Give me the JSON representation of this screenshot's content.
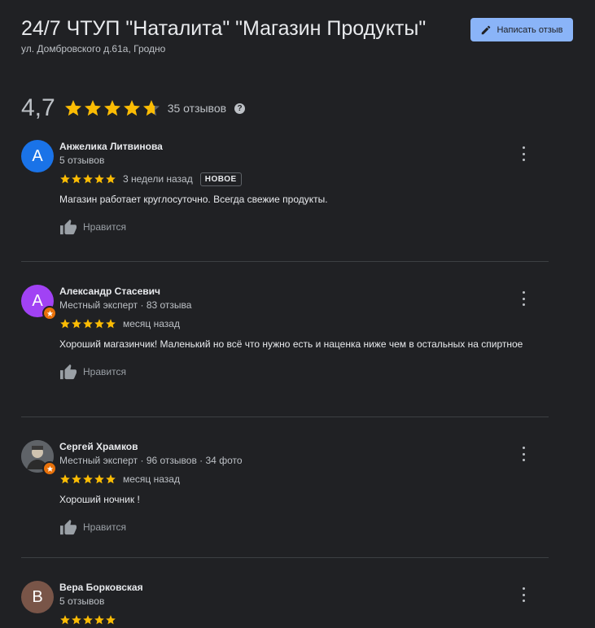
{
  "place": {
    "title": "24/7 ЧТУП \"Наталита\" \"Магазин Продукты\"",
    "address": "ул. Домбровского д.61а, Гродно"
  },
  "write_button": {
    "label": "Написать отзыв",
    "icon": "pencil-icon"
  },
  "summary": {
    "rating": "4,7",
    "rating_value": 4.7,
    "reviews_count": "35 отзывов",
    "help_symbol": "?"
  },
  "colors": {
    "star": "#fbbc04",
    "accent": "#8ab4f8",
    "background": "#202124",
    "badge": "#e8710a"
  },
  "reviews": [
    {
      "avatar_letter": "А",
      "avatar_color": "#1a73e8",
      "name": "Анжелика Литвинова",
      "meta": "5 отзывов",
      "stars": 5,
      "when": "3 недели назад",
      "new_label": "НОВОЕ",
      "text": "Магазин работает круглосуточно. Всегда свежие продукты.",
      "like_label": "Нравится"
    },
    {
      "avatar_letter": "А",
      "avatar_color": "#a142f4",
      "name": "Александр Стасевич",
      "meta": "Местный эксперт · 83 отзыва",
      "stars": 5,
      "when": "месяц назад",
      "text": "Хороший магазинчик! Маленький но всё что нужно есть и наценка ниже чем в остальных на спиртное",
      "like_label": "Нравится"
    },
    {
      "avatar_letter": "",
      "avatar_color": "#4a4f55",
      "name": "Сергей Храмков",
      "meta": "Местный эксперт · 96 отзывов · 34 фото",
      "stars": 5,
      "when": "месяц назад",
      "text": "Хороший ночник !",
      "like_label": "Нравится"
    },
    {
      "avatar_letter": "В",
      "avatar_color": "#795548",
      "name": "Вера Борковская",
      "meta": "5 отзывов",
      "stars": 5
    }
  ]
}
